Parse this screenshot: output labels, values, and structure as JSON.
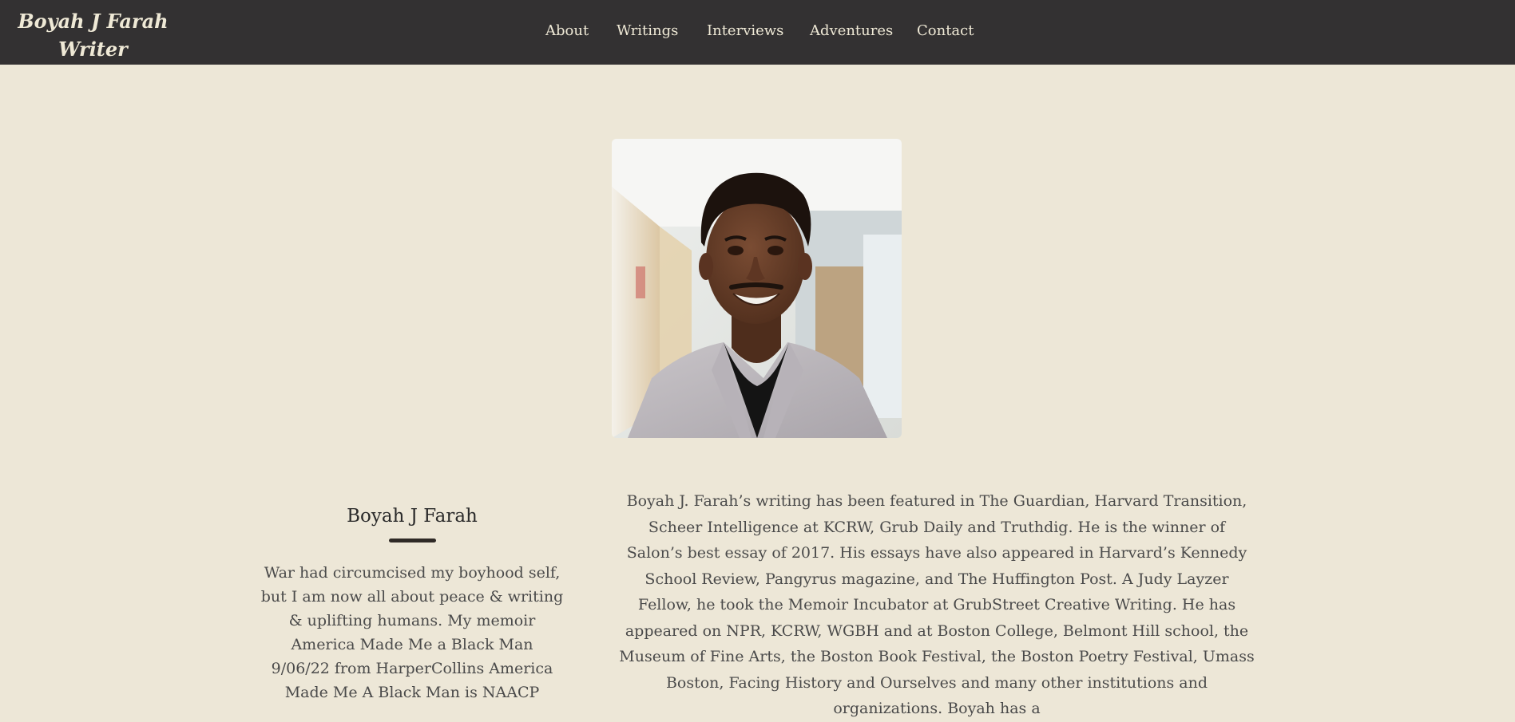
{
  "header": {
    "site_title_line1": "Boyah J Farah",
    "site_title_line2": "Writer",
    "nav": [
      "About",
      "Writings",
      "Interviews",
      "Adventures",
      "Contact"
    ]
  },
  "profile": {
    "photo_alt": "Boyah J Farah",
    "name": "Boyah J Farah",
    "tagline": "War had circumcised my boyhood self, but I am now all about peace & writing & uplifting humans. My memoir America Made Me a Black Man 9/06/22 from HarperCollins America Made Me A Black Man is NAACP",
    "bio": "Boyah J. Farah’s writing has been featured in The Guardian, Harvard Transition, Scheer Intelligence at KCRW, Grub Daily and Truthdig. He is the winner of Salon’s best essay of 2017. His essays have also appeared in Harvard’s Kennedy School Review, Pangyrus magazine, and The Huffington Post. A Judy Layzer Fellow, he took the Memoir Incubator at GrubStreet Creative Writing. He has appeared on NPR, KCRW, WGBH and at Boston College, Belmont Hill school, the Museum of Fine Arts, the Boston Book Festival, the Boston Poetry Festival, Umass Boston, Facing History and Ourselves and many other institutions and organizations. Boyah has a"
  },
  "colors": {
    "header_bg": "#333132",
    "page_bg": "#ede7d7",
    "header_text": "#efe9d6",
    "body_text": "#4a4a4a"
  }
}
